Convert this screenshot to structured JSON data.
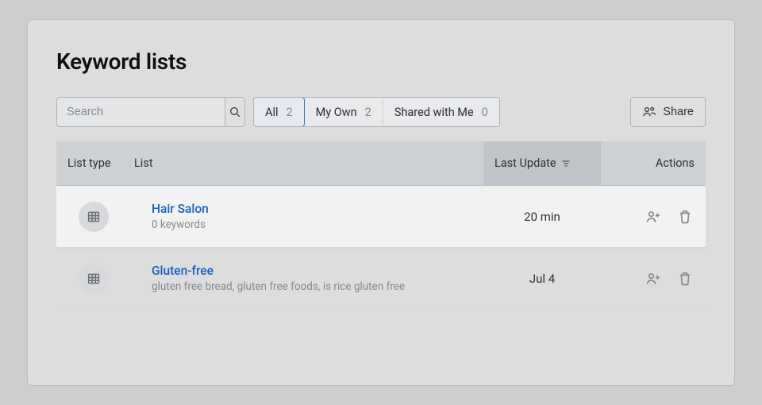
{
  "title": "Keyword lists",
  "search": {
    "placeholder": "Search"
  },
  "filters": {
    "all": {
      "label": "All",
      "count": "2",
      "active": true
    },
    "own": {
      "label": "My Own",
      "count": "2",
      "active": false
    },
    "shared": {
      "label": "Shared with Me",
      "count": "0",
      "active": false
    }
  },
  "share_label": "Share",
  "columns": {
    "type": "List type",
    "list": "List",
    "update": "Last Update",
    "actions": "Actions"
  },
  "rows": [
    {
      "name": "Hair Salon",
      "desc": "0 keywords",
      "update": "20 min",
      "highlighted": true
    },
    {
      "name": "Gluten-free",
      "desc": "gluten free bread, gluten free foods, is rice gluten free",
      "update": "Jul 4",
      "highlighted": false
    }
  ]
}
